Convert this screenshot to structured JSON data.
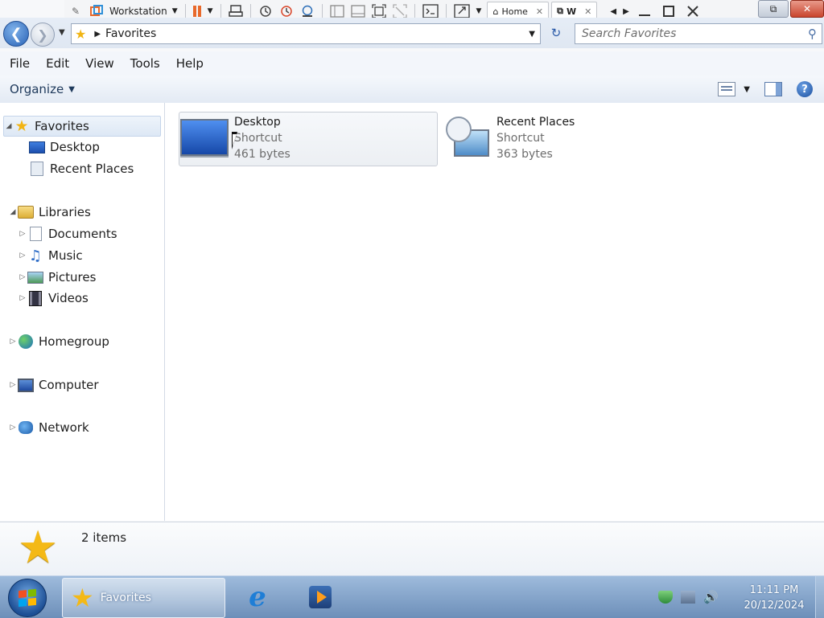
{
  "vm_toolbar": {
    "vm_name": "Workstation",
    "tabs": [
      {
        "label": "Home"
      },
      {
        "label": "W"
      }
    ]
  },
  "explorer": {
    "breadcrumb": [
      "Favorites"
    ],
    "search": {
      "placeholder": "Search Favorites"
    },
    "menu": [
      "File",
      "Edit",
      "View",
      "Tools",
      "Help"
    ],
    "organize_label": "Organize",
    "nav": {
      "favorites": {
        "label": "Favorites",
        "items": [
          "Desktop",
          "Recent Places"
        ]
      },
      "libraries": {
        "label": "Libraries",
        "items": [
          "Documents",
          "Music",
          "Pictures",
          "Videos"
        ]
      },
      "homegroup": "Homegroup",
      "computer": "Computer",
      "network": "Network"
    },
    "files": [
      {
        "name": "Desktop",
        "type": "Shortcut",
        "size": "461 bytes",
        "icon": "desktop-icon"
      },
      {
        "name": "Recent Places",
        "type": "Shortcut",
        "size": "363 bytes",
        "icon": "recent-places-icon"
      }
    ],
    "details": {
      "count": "2 items"
    }
  },
  "taskbar": {
    "active_window": "Favorites",
    "clock": {
      "time": "11:11 PM",
      "date": "20/12/2024"
    }
  },
  "colors": {
    "accent": "#2a63b6",
    "star": "#f2b515",
    "taskbar": "#6d8fb9"
  }
}
